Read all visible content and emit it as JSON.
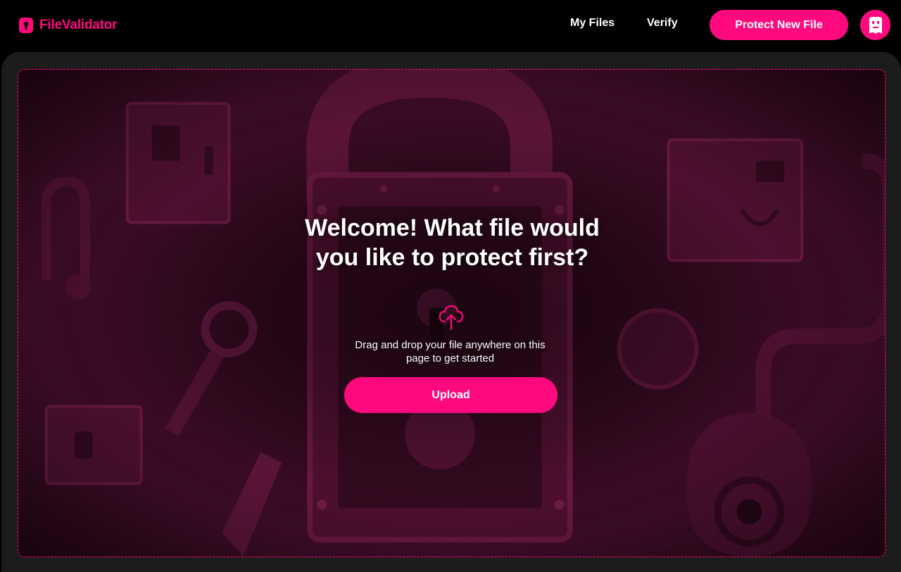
{
  "brand": {
    "name": "FileValidator",
    "logo_icon": "lock-icon",
    "accent": "#ff0a7e"
  },
  "nav": {
    "my_files": "My Files",
    "verify": "Verify",
    "cta": "Protect New File",
    "avatar_icon": "user-avatar-icon"
  },
  "main": {
    "headline": "Welcome! What file would you like to protect first?",
    "upload_icon": "cloud-upload-icon",
    "hint": "Drag and drop your file anywhere on this page to get started",
    "upload_label": "Upload"
  },
  "colors": {
    "background": "#000000",
    "panel": "#1c1c1c",
    "illustration": "#4a0f2e"
  }
}
